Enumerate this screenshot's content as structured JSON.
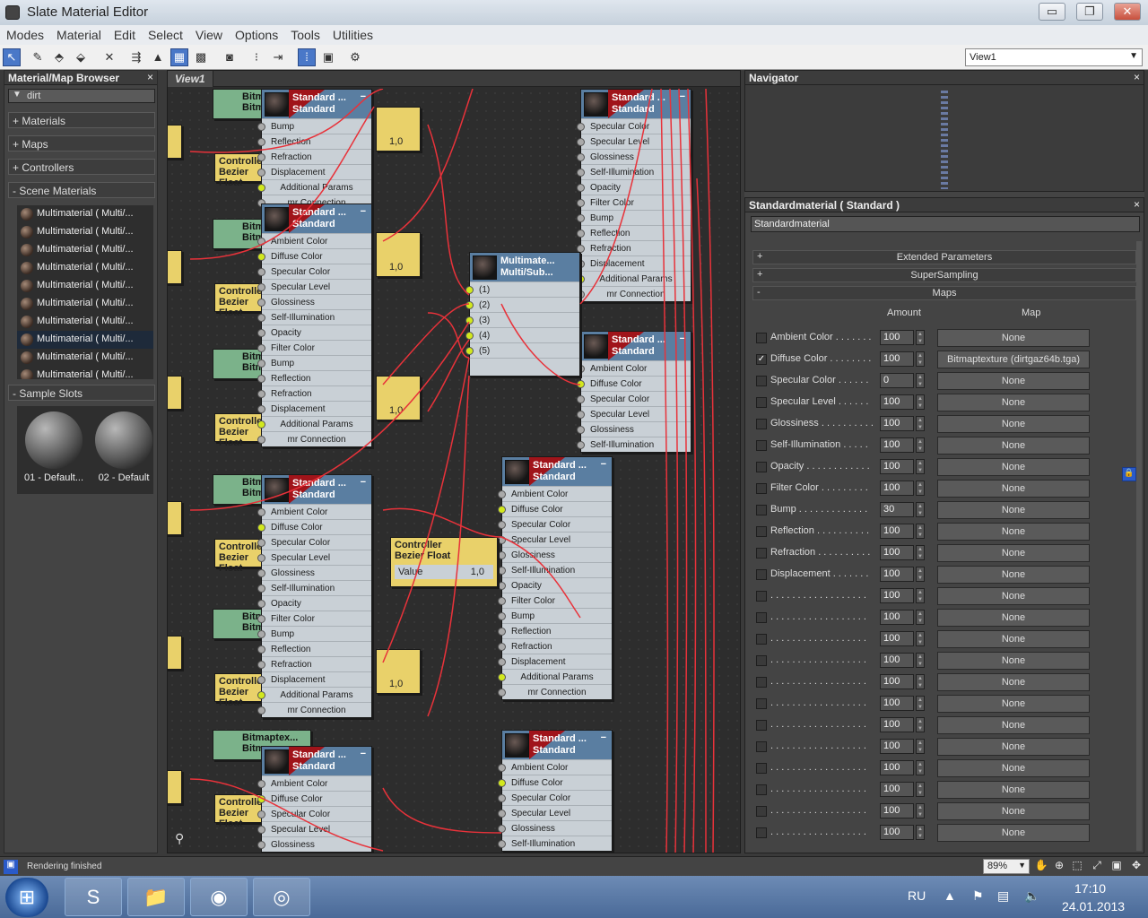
{
  "window": {
    "title": "Slate Material Editor",
    "min_label": "▭",
    "max_label": "❐",
    "close_label": "✕"
  },
  "menu": [
    "Modes",
    "Material",
    "Edit",
    "Select",
    "View",
    "Options",
    "Tools",
    "Utilities"
  ],
  "toolbar": {
    "view_select": "View1"
  },
  "browser": {
    "title": "Material/Map Browser",
    "close": "×",
    "search_value": "dirt",
    "rollouts": [
      {
        "label": "+ Materials"
      },
      {
        "label": "+ Maps"
      },
      {
        "label": "+ Controllers"
      },
      {
        "label": "- Scene Materials"
      }
    ],
    "scene_materials": [
      "Multimaterial  ( Multi/...",
      "Multimaterial  ( Multi/...",
      "Multimaterial  ( Multi/...",
      "Multimaterial  ( Multi/...",
      "Multimaterial  ( Multi/...",
      "Multimaterial  ( Multi/...",
      "Multimaterial  ( Multi/...",
      "Multimaterial  ( Multi/...",
      "Multimaterial  ( Multi/...",
      "Multimaterial  ( Multi/..."
    ],
    "sample_slots_label": "- Sample Slots",
    "sample_slots": [
      "01 - Default...",
      "02 - Default"
    ]
  },
  "viewport": {
    "tab": "View1"
  },
  "nodes": {
    "standard_title": "Standard ...",
    "standard_sub": "Standard",
    "multi_title": "Multimate...",
    "multi_sub": "Multi/Sub...",
    "controller": "Controller",
    "bezier": "Bezier Float",
    "bitmap_title": "Bitmaptex...",
    "bitmap_sub": "Bitmap",
    "value_label": "Value",
    "value": "1,0",
    "slots": [
      "Ambient Color",
      "Diffuse Color",
      "Specular Color",
      "Specular Level",
      "Glossiness",
      "Self-Illumination",
      "Opacity",
      "Filter Color",
      "Bump",
      "Reflection",
      "Refraction",
      "Displacement",
      "Additional Params",
      "mr Connection"
    ],
    "multi_slots": [
      "(1)",
      "(2)",
      "(3)",
      "(4)",
      "(5)"
    ]
  },
  "navigator": {
    "title": "Navigator",
    "close": "×"
  },
  "props": {
    "title": "Standardmaterial  ( Standard )",
    "close": "×",
    "name": "Standardmaterial",
    "rollouts": [
      {
        "sign": "+",
        "label": "Extended Parameters"
      },
      {
        "sign": "+",
        "label": "SuperSampling"
      },
      {
        "sign": "-",
        "label": "Maps"
      }
    ],
    "col_amount": "Amount",
    "col_map": "Map",
    "maps": [
      {
        "label": "Ambient Color . . . . . . .",
        "amount": "100",
        "map": "None",
        "checked": ""
      },
      {
        "label": "Diffuse Color . . . . . . . .",
        "amount": "100",
        "map": "Bitmaptexture (dirtgaz64b.tga)",
        "checked": "✓"
      },
      {
        "label": "Specular Color . . . . . .",
        "amount": "0",
        "map": "None",
        "checked": ""
      },
      {
        "label": "Specular Level . . . . . .",
        "amount": "100",
        "map": "None",
        "checked": ""
      },
      {
        "label": "Glossiness . . . . . . . . . .",
        "amount": "100",
        "map": "None",
        "checked": ""
      },
      {
        "label": "Self-Illumination . . . . .",
        "amount": "100",
        "map": "None",
        "checked": ""
      },
      {
        "label": "Opacity . . . . . . . . . . . .",
        "amount": "100",
        "map": "None",
        "checked": ""
      },
      {
        "label": "Filter Color . . . . . . . . .",
        "amount": "100",
        "map": "None",
        "checked": ""
      },
      {
        "label": "Bump . . . . . . . . . . . . .",
        "amount": "30",
        "map": "None",
        "checked": ""
      },
      {
        "label": "Reflection . . . . . . . . . .",
        "amount": "100",
        "map": "None",
        "checked": ""
      },
      {
        "label": "Refraction . . . . . . . . . .",
        "amount": "100",
        "map": "None",
        "checked": ""
      },
      {
        "label": "Displacement . . . . . . .",
        "amount": "100",
        "map": "None",
        "checked": ""
      },
      {
        "label": ". . . . . . . . . . . . . . . . . .",
        "amount": "100",
        "map": "None",
        "checked": ""
      },
      {
        "label": ". . . . . . . . . . . . . . . . . .",
        "amount": "100",
        "map": "None",
        "checked": ""
      },
      {
        "label": ". . . . . . . . . . . . . . . . . .",
        "amount": "100",
        "map": "None",
        "checked": ""
      },
      {
        "label": ". . . . . . . . . . . . . . . . . .",
        "amount": "100",
        "map": "None",
        "checked": ""
      },
      {
        "label": ". . . . . . . . . . . . . . . . . .",
        "amount": "100",
        "map": "None",
        "checked": ""
      },
      {
        "label": ". . . . . . . . . . . . . . . . . .",
        "amount": "100",
        "map": "None",
        "checked": ""
      },
      {
        "label": ". . . . . . . . . . . . . . . . . .",
        "amount": "100",
        "map": "None",
        "checked": ""
      },
      {
        "label": ". . . . . . . . . . . . . . . . . .",
        "amount": "100",
        "map": "None",
        "checked": ""
      },
      {
        "label": ". . . . . . . . . . . . . . . . . .",
        "amount": "100",
        "map": "None",
        "checked": ""
      },
      {
        "label": ". . . . . . . . . . . . . . . . . .",
        "amount": "100",
        "map": "None",
        "checked": ""
      },
      {
        "label": ". . . . . . . . . . . . . . . . . .",
        "amount": "100",
        "map": "None",
        "checked": ""
      },
      {
        "label": ". . . . . . . . . . . . . . . . . .",
        "amount": "100",
        "map": "None",
        "checked": ""
      }
    ]
  },
  "status": {
    "text": "Rendering finished",
    "zoom": "89%"
  },
  "taskbar": {
    "lang": "RU",
    "time": "17:10",
    "date": "24.01.2013"
  },
  "colors": {
    "wire": "#e8323a",
    "standard_head": "#5a7ea1",
    "controller": "#e9d16a",
    "bitmap": "#7bb28a",
    "socket_on": "#d2e81e"
  }
}
